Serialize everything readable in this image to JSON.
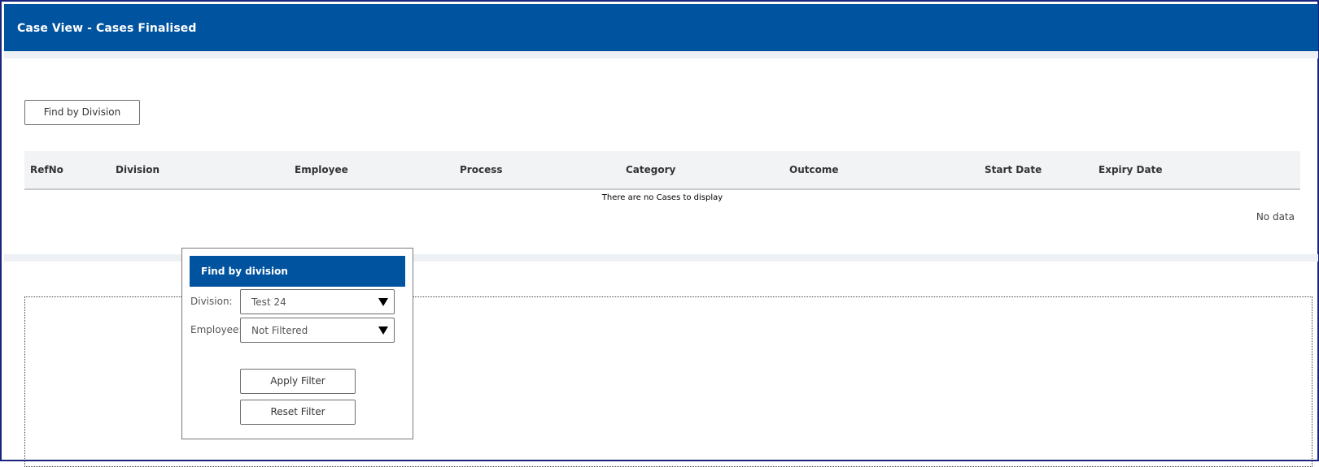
{
  "header": {
    "title": "Case View - Cases Finalised"
  },
  "toolbar": {
    "find_by_division_label": "Find by Division"
  },
  "grid": {
    "columns": [
      "RefNo",
      "Division",
      "Employee",
      "Process",
      "Category",
      "Outcome",
      "Start Date",
      "Expiry Date"
    ],
    "empty_message": "There are no Cases to display",
    "no_data_label": "No data"
  },
  "filter_popup": {
    "title": "Find by division",
    "division_label": "Division:",
    "division_value": "Test 24",
    "employee_label": "Employee:",
    "employee_value": "Not Filtered",
    "apply_label": "Apply Filter",
    "reset_label": "Reset Filter"
  },
  "icons": {
    "dropdown": "chevron-down-icon"
  },
  "colors": {
    "header_bg": "#00539f",
    "header_text": "#ffffff",
    "grid_header_bg": "#f2f3f5"
  }
}
